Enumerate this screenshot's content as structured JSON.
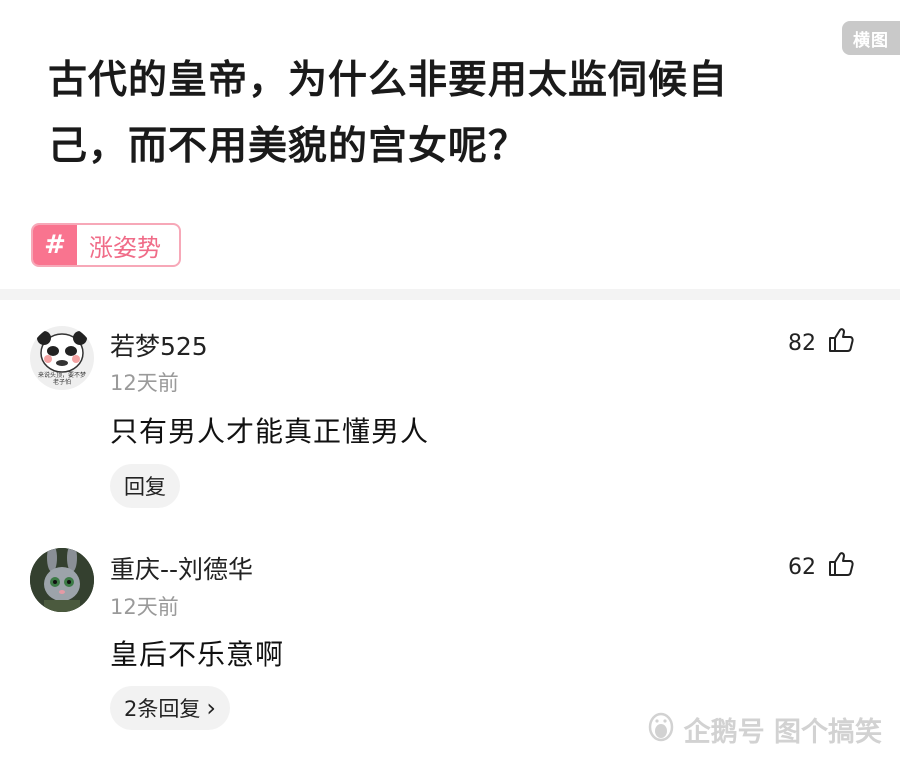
{
  "badge": {
    "label": "横图"
  },
  "article": {
    "title_line1": "古代的皇帝，为什么非要用太监伺候自",
    "title_line2": "己，而不用美貌的宫女呢？"
  },
  "tag": {
    "symbol": "#",
    "label": "涨姿势"
  },
  "comments": [
    {
      "username": "若梦525",
      "time": "12天前",
      "content": "只有男人才能真正懂男人",
      "likes": "82",
      "reply_label": "回复",
      "avatar_icon": "panda-meme-avatar",
      "avatar_caption_line1": "来说头顶，要不梦",
      "avatar_caption_line2": "老子怕"
    },
    {
      "username": "重庆--刘德华",
      "time": "12天前",
      "content": "皇后不乐意啊",
      "likes": "62",
      "reply_label": "2条回复",
      "reply_chevron": "›",
      "avatar_icon": "bunny-cartoon-avatar"
    }
  ],
  "watermark": {
    "label": "企鹅号 图个搞笑",
    "icon": "penguin-icon"
  }
}
